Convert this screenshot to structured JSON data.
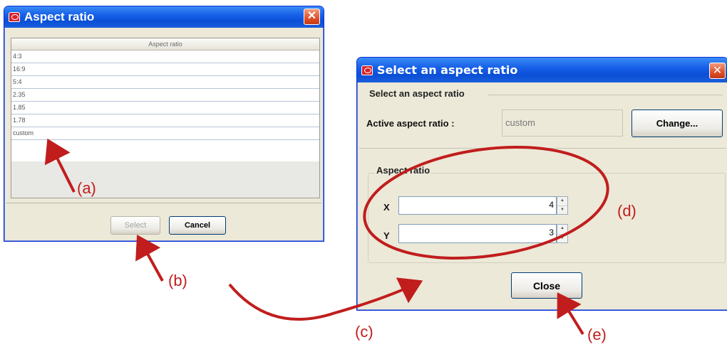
{
  "window1": {
    "title": "Aspect ratio",
    "column_header": "Aspect ratio",
    "rows": [
      "4:3",
      "16:9",
      "5:4",
      "2.35",
      "1.85",
      "1.78",
      "custom"
    ],
    "select_label": "Select",
    "cancel_label": "Cancel"
  },
  "window2": {
    "title": "Select an aspect ratio",
    "group_title": "Select an aspect ratio",
    "active_label": "Active aspect ratio :",
    "active_value": "custom",
    "change_label": "Change...",
    "aspect_group_title": "Aspect ratio",
    "x_label": "X",
    "x_value": "4",
    "y_label": "Y",
    "y_value": "3",
    "close_label": "Close"
  },
  "annotations": {
    "a": "(a)",
    "b": "(b)",
    "c": "(c)",
    "d": "(d)",
    "e": "(e)",
    "color": "#c11d1d"
  },
  "colors": {
    "titlebar_blue": "#0a4fd6",
    "dialog_background": "#ece9d8",
    "close_button_orange": "#e0512a"
  }
}
